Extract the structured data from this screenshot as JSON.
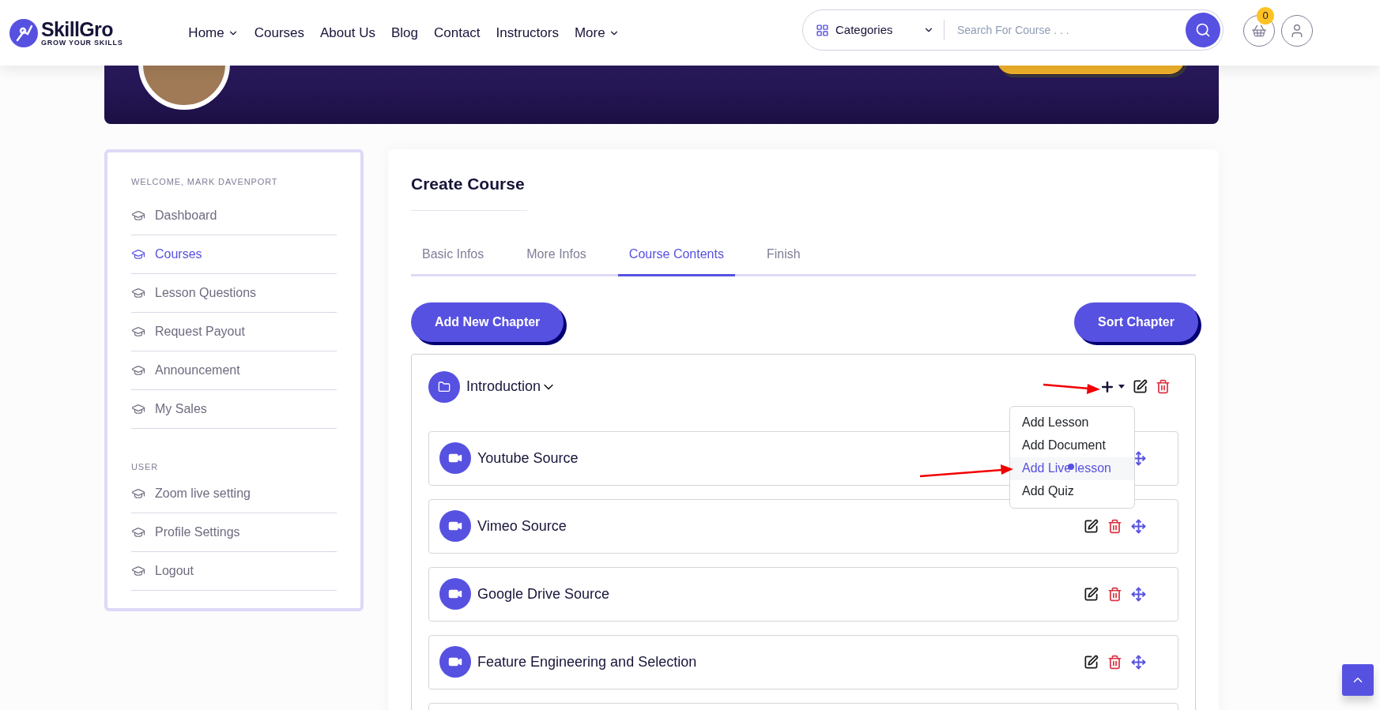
{
  "header": {
    "logo": {
      "name": "SkillGro",
      "tagline": "GROW YOUR SKILLS"
    },
    "nav": [
      {
        "label": "Home",
        "has_menu": true
      },
      {
        "label": "Courses",
        "has_menu": false
      },
      {
        "label": "About Us",
        "has_menu": false
      },
      {
        "label": "Blog",
        "has_menu": false
      },
      {
        "label": "Contact",
        "has_menu": false
      },
      {
        "label": "Instructors",
        "has_menu": false
      },
      {
        "label": "More",
        "has_menu": true
      }
    ],
    "search": {
      "category": "Categories",
      "placeholder": "Search For Course . . ."
    },
    "cart_count": "0"
  },
  "sidebar": {
    "welcome": "WELCOME, MARK DAVENPORT",
    "items": [
      {
        "label": "Dashboard",
        "selected": false
      },
      {
        "label": "Courses",
        "selected": true
      },
      {
        "label": "Lesson Questions",
        "selected": false
      },
      {
        "label": "Request Payout",
        "selected": false
      },
      {
        "label": "Announcement",
        "selected": false
      },
      {
        "label": "My Sales",
        "selected": false
      }
    ],
    "user_heading": "USER",
    "user_items": [
      {
        "label": "Zoom live setting",
        "selected": false
      },
      {
        "label": "Profile Settings",
        "selected": false
      },
      {
        "label": "Logout",
        "selected": false
      }
    ]
  },
  "main": {
    "title": "Create Course",
    "tabs": [
      {
        "label": "Basic Infos",
        "selected": false
      },
      {
        "label": "More Infos",
        "selected": false
      },
      {
        "label": "Course Contents",
        "selected": true
      },
      {
        "label": "Finish",
        "selected": false
      }
    ],
    "add_chapter": "Add New Chapter",
    "sort_chapter": "Sort Chapter",
    "chapter": {
      "title": "Introduction",
      "expanded": true,
      "menu_open": true,
      "menu": [
        {
          "label": "Add Lesson",
          "selected": false
        },
        {
          "label": "Add Document",
          "selected": false
        },
        {
          "label": "Add Live lesson",
          "selected": true
        },
        {
          "label": "Add Quiz",
          "selected": false
        }
      ],
      "lessons": [
        {
          "title": "Youtube Source",
          "edit_hidden": true
        },
        {
          "title": "Vimeo Source",
          "edit_hidden": false
        },
        {
          "title": "Google Drive Source",
          "edit_hidden": false
        },
        {
          "title": "Feature Engineering and Selection",
          "edit_hidden": false
        }
      ]
    }
  }
}
